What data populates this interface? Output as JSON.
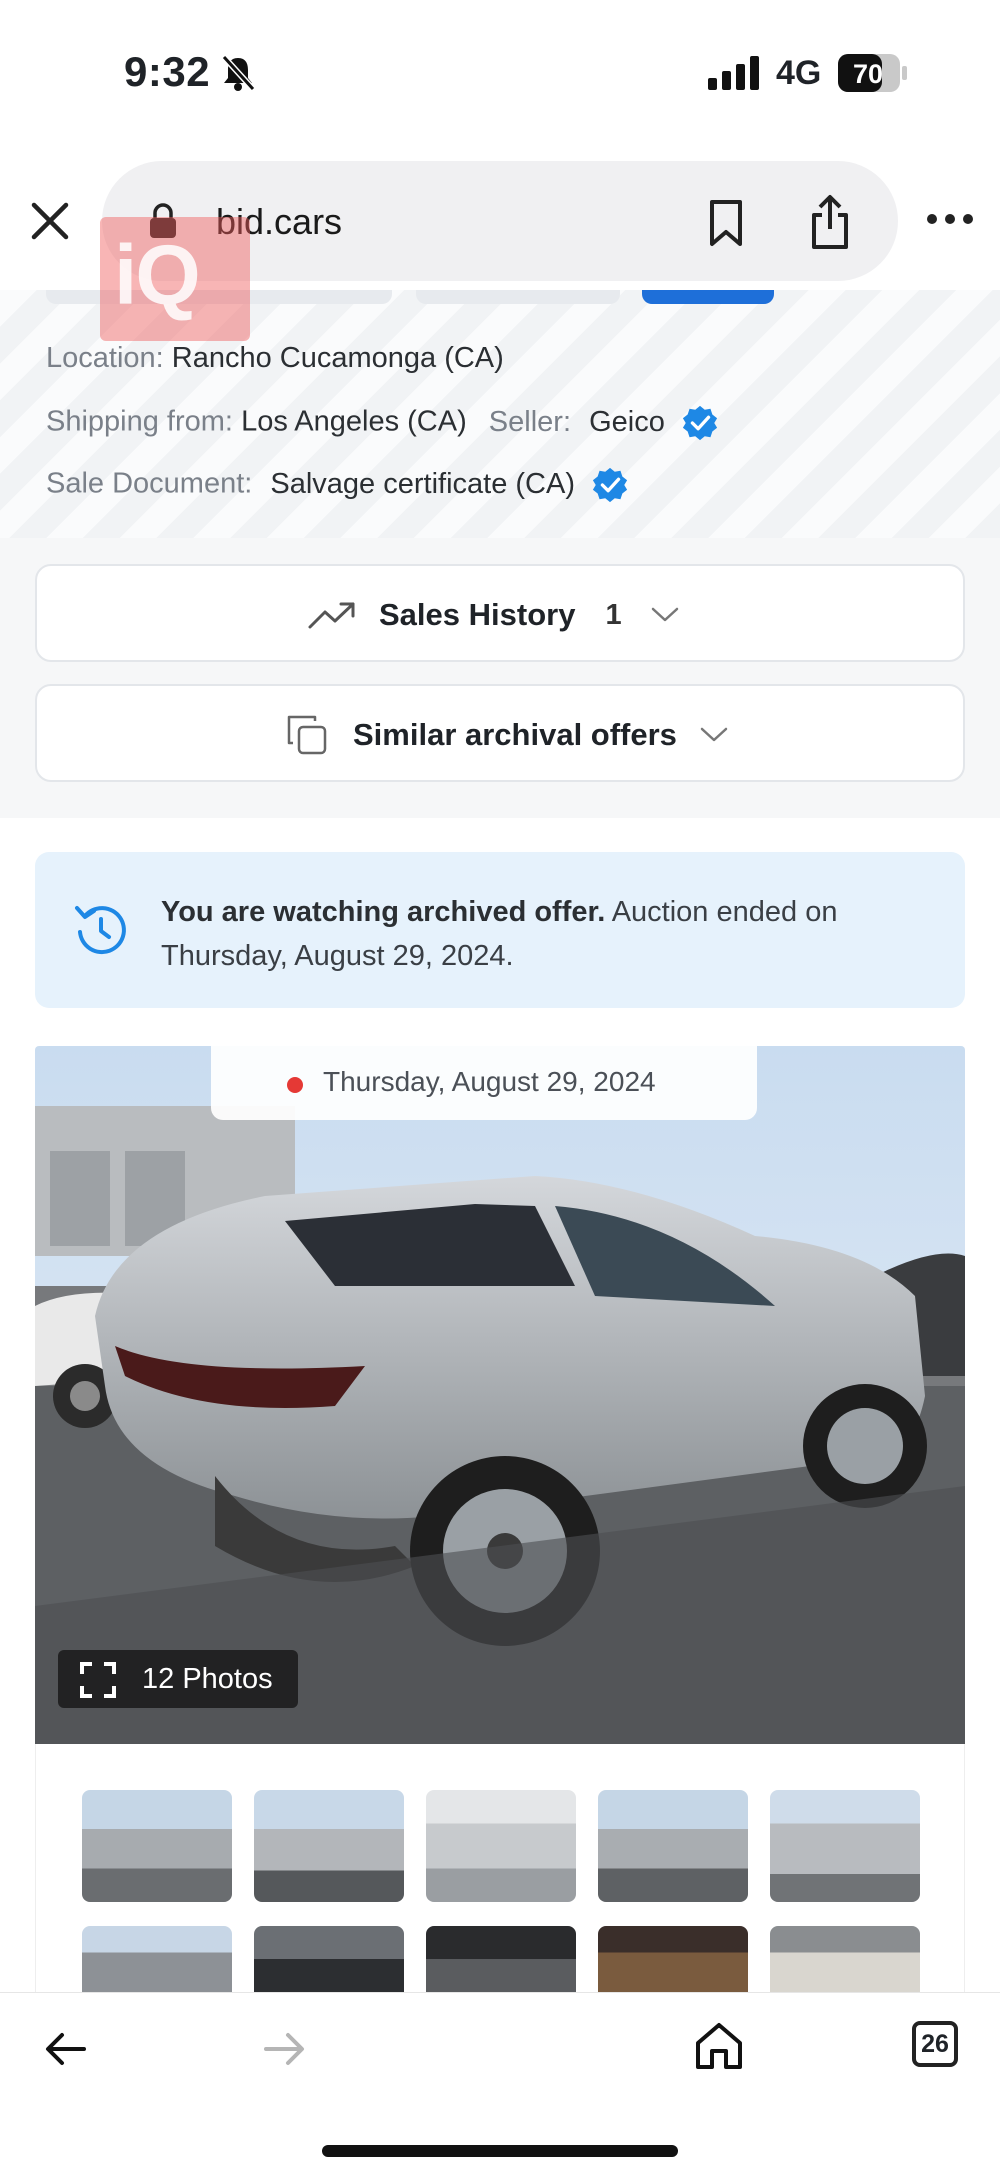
{
  "status_bar": {
    "time": "9:32",
    "network": "4G",
    "battery": "70"
  },
  "browser": {
    "url": "bid.cars",
    "watermark": "iQ"
  },
  "info": {
    "location_label": "Location:",
    "location_value": "Rancho Cucamonga (CA)",
    "shipping_label": "Shipping from:",
    "shipping_value": "Los Angeles (CA)",
    "seller_label": "Seller:",
    "seller_value": "Geico",
    "sale_doc_label": "Sale Document:",
    "sale_doc_value": "Salvage certificate (CA)"
  },
  "sections": {
    "sales_history_label": "Sales History",
    "sales_history_count": "1",
    "similar_offers_label": "Similar archival offers"
  },
  "alert": {
    "bold_text": "You are watching archived offer.",
    "text": " Auction ended on Thursday, August 29, 2024."
  },
  "photo": {
    "date": "Thursday, August 29, 2024",
    "photos_count_label": "12 Photos"
  },
  "nav": {
    "tabs_count": "26"
  },
  "colors": {
    "accent": "#1e88e5",
    "alert_bg": "#e6f2fc",
    "red_dot": "#e53935"
  }
}
